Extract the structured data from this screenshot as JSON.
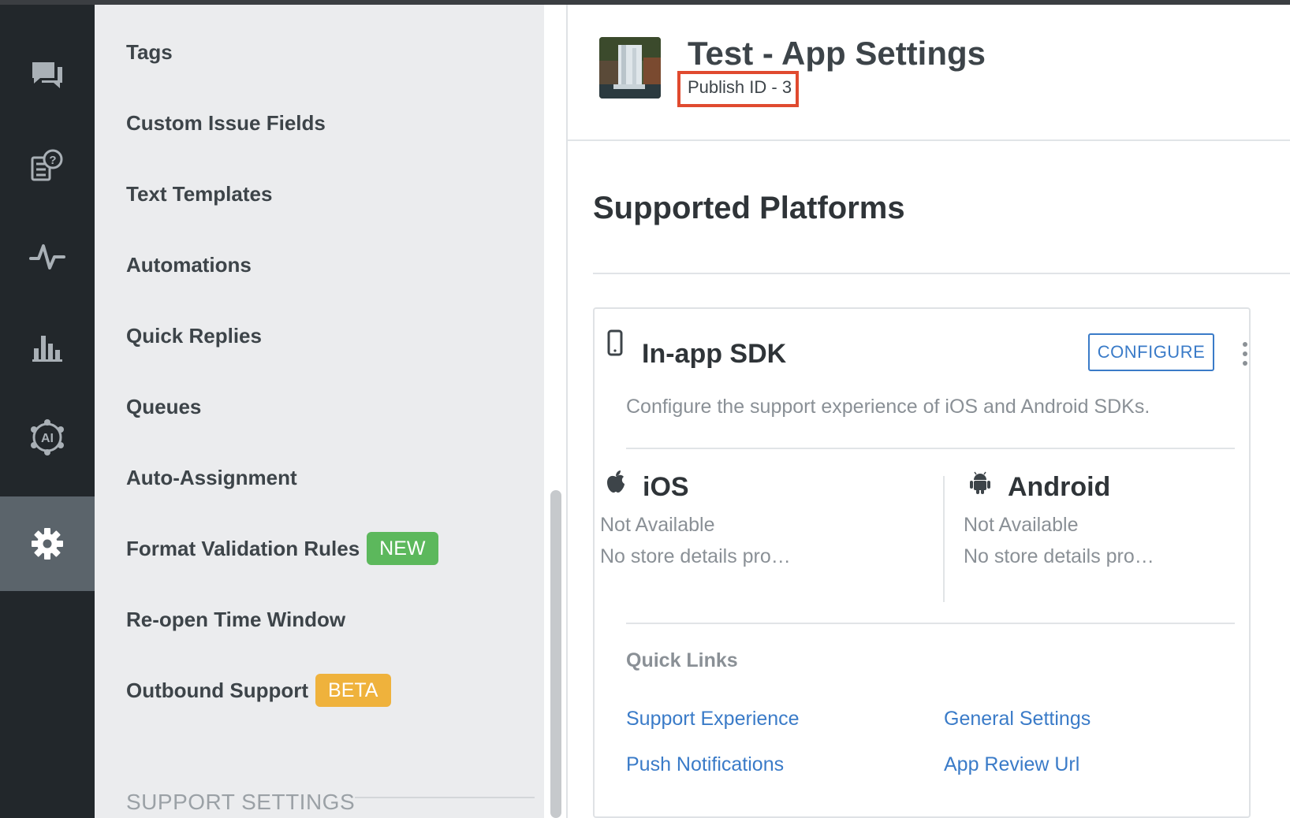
{
  "colors": {
    "rail_bg": "#22272b",
    "rail_active": "#5b646b",
    "menu_bg": "#ebecee",
    "accent_blue": "#3a7bc8",
    "badge_new": "#5cb85c",
    "badge_beta": "#efb23c",
    "highlight_box": "#e04a2f"
  },
  "rail": {
    "items": [
      {
        "icon": "chat-icon"
      },
      {
        "icon": "faq-icon"
      },
      {
        "icon": "activity-icon"
      },
      {
        "icon": "analytics-icon"
      },
      {
        "icon": "ai-icon"
      },
      {
        "icon": "gear-icon",
        "active": true
      }
    ]
  },
  "settings_menu": {
    "items": [
      {
        "label": "Tags"
      },
      {
        "label": "Custom Issue Fields"
      },
      {
        "label": "Text Templates"
      },
      {
        "label": "Automations"
      },
      {
        "label": "Quick Replies"
      },
      {
        "label": "Queues"
      },
      {
        "label": "Auto-Assignment"
      },
      {
        "label": "Format Validation Rules",
        "badge": "NEW"
      },
      {
        "label": "Re-open Time Window"
      },
      {
        "label": "Outbound Support",
        "badge": "BETA"
      }
    ],
    "section_title": "SUPPORT SETTINGS"
  },
  "app": {
    "title": "Test - App Settings",
    "publish_id": "Publish ID - 3"
  },
  "main": {
    "section_heading": "Supported Platforms"
  },
  "sdk_card": {
    "title": "In-app SDK",
    "configure_label": "CONFIGURE",
    "description": "Configure the support experience of iOS and Android SDKs.",
    "platforms": [
      {
        "name": "iOS",
        "icon": "apple-icon",
        "status": "Not Available",
        "store": "No store details pro…"
      },
      {
        "name": "Android",
        "icon": "android-icon",
        "status": "Not Available",
        "store": "No store details pro…"
      }
    ],
    "quick_links_title": "Quick Links",
    "quick_links": [
      "Support Experience",
      "General Settings",
      "Push Notifications",
      "App Review Url"
    ]
  }
}
